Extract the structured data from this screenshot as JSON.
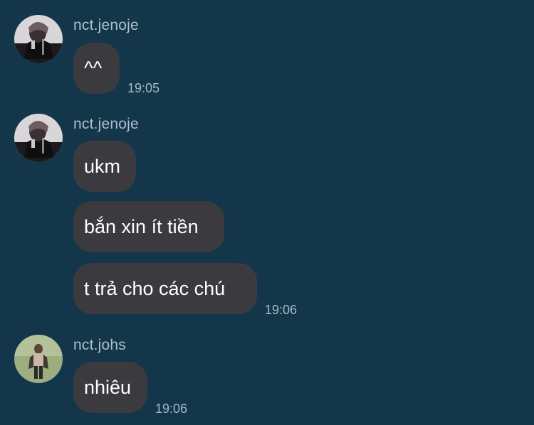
{
  "messages": [
    {
      "username": "nct.jenoje",
      "avatar_icon": "user-avatar-photo-dark",
      "bubbles": [
        {
          "text": "^^"
        }
      ],
      "time": "19:05"
    },
    {
      "username": "nct.jenoje",
      "avatar_icon": "user-avatar-photo-dark",
      "bubbles": [
        {
          "text": "ukm"
        },
        {
          "text": "bắn xin ít tiền"
        },
        {
          "text": "t trả cho các chú"
        }
      ],
      "time": "19:06"
    },
    {
      "username": "nct.johs",
      "avatar_icon": "user-avatar-photo-green",
      "bubbles": [
        {
          "text": "nhiêu"
        }
      ],
      "time": "19:06"
    }
  ],
  "colors": {
    "background": "#13364a",
    "bubble": "#3b3a3f",
    "username": "#aebfcc",
    "timestamp": "#a6b8c5",
    "message_text": "#ffffff"
  }
}
